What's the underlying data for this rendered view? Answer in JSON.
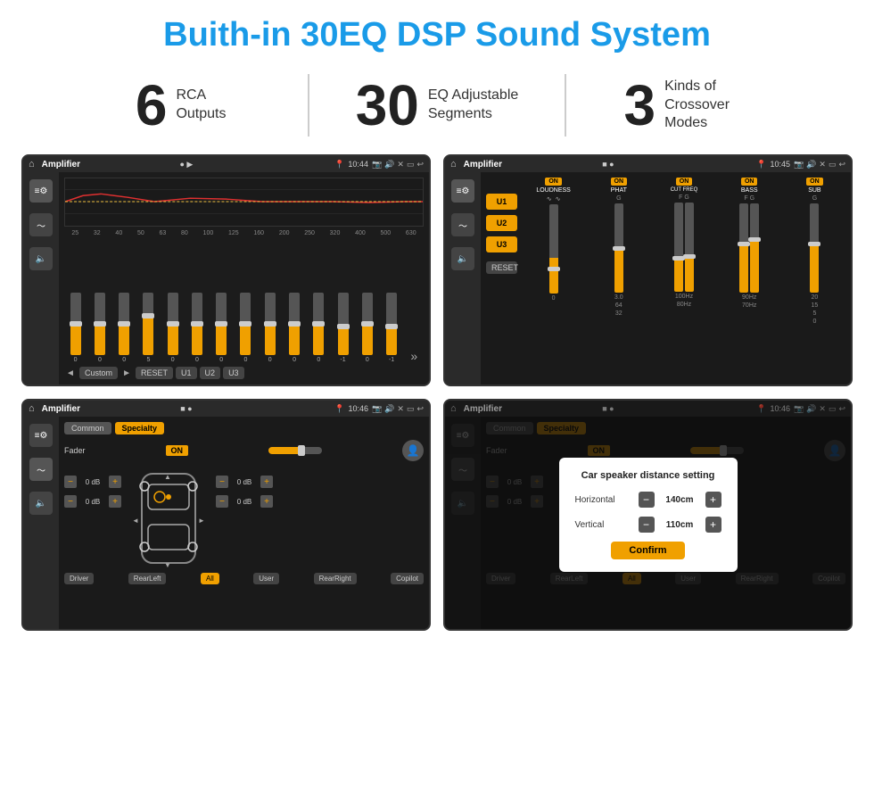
{
  "header": {
    "title": "Buith-in 30EQ DSP Sound System"
  },
  "stats": [
    {
      "number": "6",
      "text": "RCA\nOutputs"
    },
    {
      "number": "30",
      "text": "EQ Adjustable\nSegments"
    },
    {
      "number": "3",
      "text": "Kinds of\nCrossover Modes"
    }
  ],
  "screens": {
    "eq": {
      "status_title": "Amplifier",
      "time": "10:44",
      "eq_bands": [
        "25",
        "32",
        "40",
        "50",
        "63",
        "80",
        "100",
        "125",
        "160",
        "200",
        "250",
        "320",
        "400",
        "500",
        "630"
      ],
      "eq_values": [
        "0",
        "0",
        "0",
        "5",
        "0",
        "0",
        "0",
        "0",
        "0",
        "0",
        "0",
        "-1",
        "0",
        "-1"
      ],
      "preset_label": "Custom",
      "buttons": [
        "RESET",
        "U1",
        "U2",
        "U3"
      ]
    },
    "crossover": {
      "status_title": "Amplifier",
      "time": "10:45",
      "presets": [
        "U1",
        "U2",
        "U3"
      ],
      "channels": [
        "LOUDNESS",
        "PHAT",
        "CUT FREQ",
        "BASS",
        "SUB"
      ],
      "reset_label": "RESET"
    },
    "fader": {
      "status_title": "Amplifier",
      "time": "10:46",
      "tabs": [
        "Common",
        "Specialty"
      ],
      "fader_label": "Fader",
      "on_label": "ON",
      "db_values": [
        "0 dB",
        "0 dB",
        "0 dB",
        "0 dB"
      ],
      "bottom_btns": [
        "Driver",
        "RearLeft",
        "All",
        "User",
        "RearRight",
        "Copilot"
      ]
    },
    "distance": {
      "status_title": "Amplifier",
      "time": "10:46",
      "tabs": [
        "Common",
        "Specialty"
      ],
      "fader_label": "Fader",
      "on_label": "ON",
      "dialog": {
        "title": "Car speaker distance setting",
        "horizontal_label": "Horizontal",
        "horizontal_value": "140cm",
        "vertical_label": "Vertical",
        "vertical_value": "110cm",
        "confirm_label": "Confirm"
      },
      "db_values": [
        "0 dB",
        "0 dB"
      ],
      "bottom_btns": [
        "Driver",
        "RearLeft",
        "All",
        "User",
        "RearRight",
        "Copilot"
      ]
    }
  }
}
